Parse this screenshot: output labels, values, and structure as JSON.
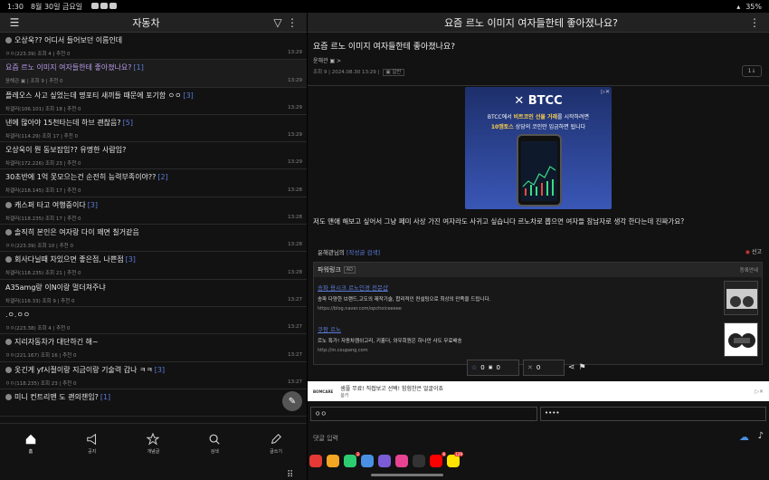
{
  "status": {
    "time": "1:30",
    "date": "8월 30일 금요일",
    "battery": "35%"
  },
  "left": {
    "title": "자동차",
    "posts": [
      {
        "title": "오상욱?? 어디서 들어보던 이름인데",
        "count": "",
        "meta": "ㅇㅇ(223.39) 조회 4 | 추천 0",
        "time": "13:29",
        "icon": true
      },
      {
        "title": "요즘 르노 이미지 여자들한테 좋아졌나요?",
        "count": "[1]",
        "meta": "윤해관 ▣ | 조회 9 | 추천 0",
        "time": "13:29",
        "active": true
      },
      {
        "title": "플레오스 사고 싶었는데 명포티 새끼들 때문에 포기함 ㅇㅇ",
        "count": "[3]",
        "meta": "차갤러(106.101) 조회 18 | 추천 0",
        "time": "13:29"
      },
      {
        "title": "낸에 많아야 15천타는데 하브 괜찮음?",
        "count": "[5]",
        "meta": "차갤러(114.29) 조회 17 | 추천 0",
        "time": "13:29"
      },
      {
        "title": "오상욱이 뭔 동보잡임?? 유명한 사람임?",
        "count": "",
        "meta": "차갤러(172.226) 조회 23 | 추천 0",
        "time": "13:29"
      },
      {
        "title": "30초반에 1억 못모으는건 순전히 능력부족이야??",
        "count": "[2]",
        "meta": "차갤러(218.145) 조회 17 | 추천 0",
        "time": "13:28"
      },
      {
        "title": "캐스퍼 타고 여행중이다",
        "count": "[3]",
        "meta": "차갤러(118.235) 조회 17 | 추천 0",
        "time": "13:28",
        "icon": true
      },
      {
        "title": "솔직히 본인은 여자랑 다이 꽤면 칠거같음",
        "count": "",
        "meta": "ㅇㅇ(223.39) 조회 10 | 추천 0",
        "time": "13:28",
        "icon": true
      },
      {
        "title": "회사다닐때 차있으면 좋은점, 나쁜점",
        "count": "[3]",
        "meta": "차갤러(118.235) 조회 21 | 추천 0",
        "time": "13:28",
        "icon": true
      },
      {
        "title": "A35amg랑 이N이랑 멀더쳐주냐",
        "count": "",
        "meta": "차갤러(116.33) 조회 9 | 추천 0",
        "time": "13:27"
      },
      {
        "title": ".ㅇ.ㅇㅇ",
        "count": "",
        "meta": "ㅇㅇ(223.38) 조회 4 | 추천 0",
        "time": "13:27"
      },
      {
        "title": "지리자동차가 대단하긴 해~",
        "count": "",
        "meta": "ㅇㅇ(221.167) 조회 16 | 추천 0",
        "time": "13:27",
        "icon": true
      },
      {
        "title": "옷긴게 yf시절이랑 지금이랑 기술력 갑나 ㅋㅋ",
        "count": "[3]",
        "meta": "ㅇㅇ(118.235) 조회 23 | 추천 0",
        "time": "13:27",
        "icon": true
      },
      {
        "title": "미니 컨트리맨 도 괜의챈임?",
        "count": "[1]",
        "meta": "",
        "time": "",
        "icon": true
      }
    ],
    "nav": [
      {
        "label": "홈",
        "icon": "home-icon",
        "active": true
      },
      {
        "label": "공지",
        "icon": "megaphone-icon"
      },
      {
        "label": "개념글",
        "icon": "star-icon"
      },
      {
        "label": "검색",
        "icon": "search-icon"
      },
      {
        "label": "글쓰기",
        "icon": "pencil-icon"
      }
    ]
  },
  "right": {
    "header_title": "요즘 르노 이미지 여자들한테 좋아졌나요?",
    "article_title": "요즘 르노 이미지 여자들한테 좋아졌나요?",
    "author": "윤해관 ▣ >",
    "meta": "조회 9 | 2024.08.30 13:29 |",
    "meta_tag": "▣ 일반",
    "pin": "1↓",
    "ad": {
      "logo": "✕ BTCC",
      "line1a": "BTCC에서 ",
      "line1b": "비트코인 선물 거래",
      "line1c": "를 시작하려면",
      "line2a": "10",
      "line2b": "엠토스",
      "line2c": " 상당의 코인만 입금하면 됩니다"
    },
    "body": "저도 맨애 해보고 싶어서 그냥 페미 사상 가진 여자라도 사귀고 싶습니다 르노차로 뽑으면 여자들 참남자로 생각 한다는데 진짜가요?",
    "sig_name": "윤해관님의 ",
    "sig_link": "[작성글 검색]",
    "report": "신고",
    "powerlink": {
      "title": "파워링크",
      "ad_tag": "AD",
      "reg": "등록안내",
      "items": [
        {
          "title": "송파 용시크 르노인경 전문샵",
          "desc": "송파 다양한 브랜드,고도의 제작기술, 합리적인 컨설팅으로 최상의 만족을 드립니다.",
          "url": "https://blog.naver.com/opchoiceeeee"
        },
        {
          "title": "쿠팡 르노",
          "desc": "르노 특가! 자동차캠쉬고리, 키홀더, 와우회원은 하나만 사도 무료배송",
          "url": "http://m.coupang.com"
        }
      ]
    },
    "votes": {
      "up": "0",
      "mini": "0",
      "down": "0"
    },
    "bottom_ad": {
      "brand": "BOMCARE",
      "text1": "샘플 무료! 직접보고 선택! 힘험찬은 얼굴이죠",
      "text2": "봄카"
    },
    "name_input": "ㅇㅇ",
    "pw_input": "••••",
    "comment_placeholder": "댓글 입력"
  },
  "dock_badges": {
    "phone": "2",
    "youtube": "6",
    "kakao": "129"
  }
}
